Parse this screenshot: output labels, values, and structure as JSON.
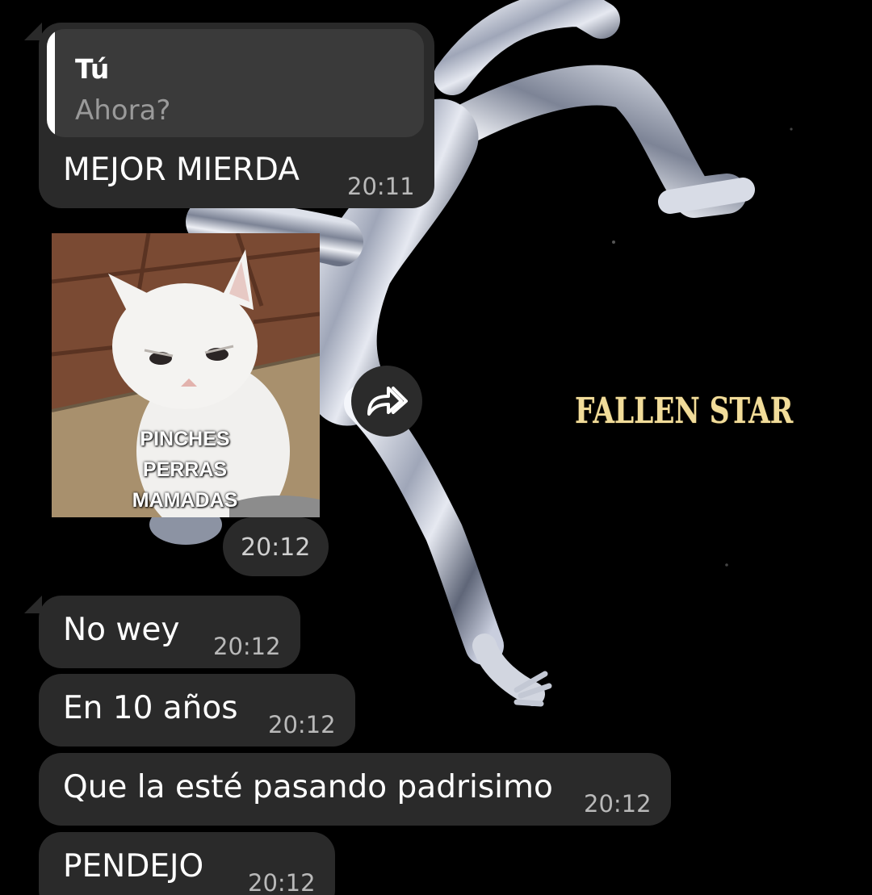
{
  "wallpaper": {
    "title_text": "FALLEN STAR",
    "title_color": "#f1dc9a"
  },
  "messages": [
    {
      "reply_to": {
        "author": "Tú",
        "text": "Ahora?"
      },
      "text": "MEJOR MIERDA",
      "time": "20:11"
    },
    {
      "sticker": {
        "caption_lines": [
          "PINCHES",
          "PERRAS",
          "MAMADAS"
        ]
      },
      "time": "20:12"
    },
    {
      "text": "No wey",
      "time": "20:12"
    },
    {
      "text": "En 10 años",
      "time": "20:12"
    },
    {
      "text": "Que la esté pasando padrisimo",
      "time": "20:12"
    },
    {
      "text": "PENDEJO",
      "time": "20:12"
    }
  ],
  "icons": {
    "forward": "forward-share-icon"
  },
  "colors": {
    "bubble": "#2a2a2a",
    "quote_bg": "#3a3a3a",
    "time_text": "#b9b9b9"
  }
}
